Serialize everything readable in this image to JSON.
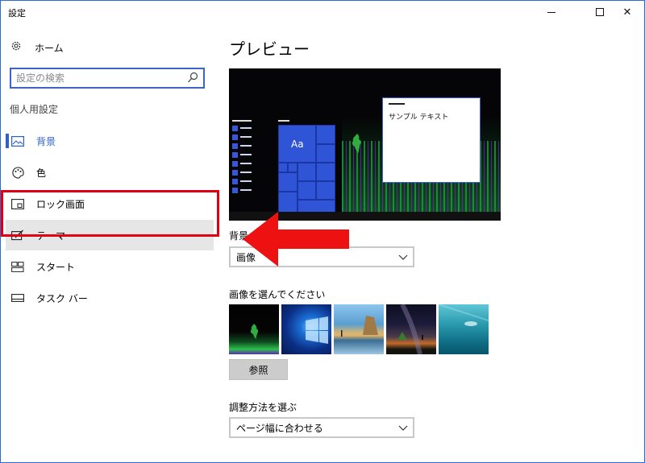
{
  "window": {
    "title": "設定",
    "controls": {
      "minimize": "minimize",
      "maximize": "maximize",
      "close": "✕"
    }
  },
  "sidebar": {
    "home": {
      "label": "ホーム",
      "icon": "gear-icon"
    },
    "search": {
      "placeholder": "設定の検索",
      "value": ""
    },
    "section_label": "個人用設定",
    "items": [
      {
        "label": "背景",
        "icon": "picture-icon",
        "active": true
      },
      {
        "label": "色",
        "icon": "palette-icon"
      },
      {
        "label": "ロック画面",
        "icon": "lock-screen-icon"
      },
      {
        "label": "テーマ",
        "icon": "theme-brush-icon",
        "selected": true
      },
      {
        "label": "スタート",
        "icon": "start-tiles-icon"
      },
      {
        "label": "タスク バー",
        "icon": "taskbar-icon"
      }
    ]
  },
  "main": {
    "title": "プレビュー",
    "preview": {
      "sample_text": "サンプル テキスト",
      "tile_label": "Aa"
    },
    "background_label": "背景",
    "background_select": {
      "value": "画像"
    },
    "choose_label": "画像を選んでください",
    "thumbnails": [
      "thumbnail-1",
      "thumbnail-2",
      "thumbnail-3",
      "thumbnail-4",
      "thumbnail-5"
    ],
    "browse_button": "参照",
    "fit_label": "調整方法を選ぶ",
    "fit_select": {
      "value": "ページ幅に合わせる"
    }
  },
  "colors": {
    "accent": "#2d5fd0",
    "annotation_red": "#e00012",
    "selected_bg": "#e6e6e6"
  }
}
